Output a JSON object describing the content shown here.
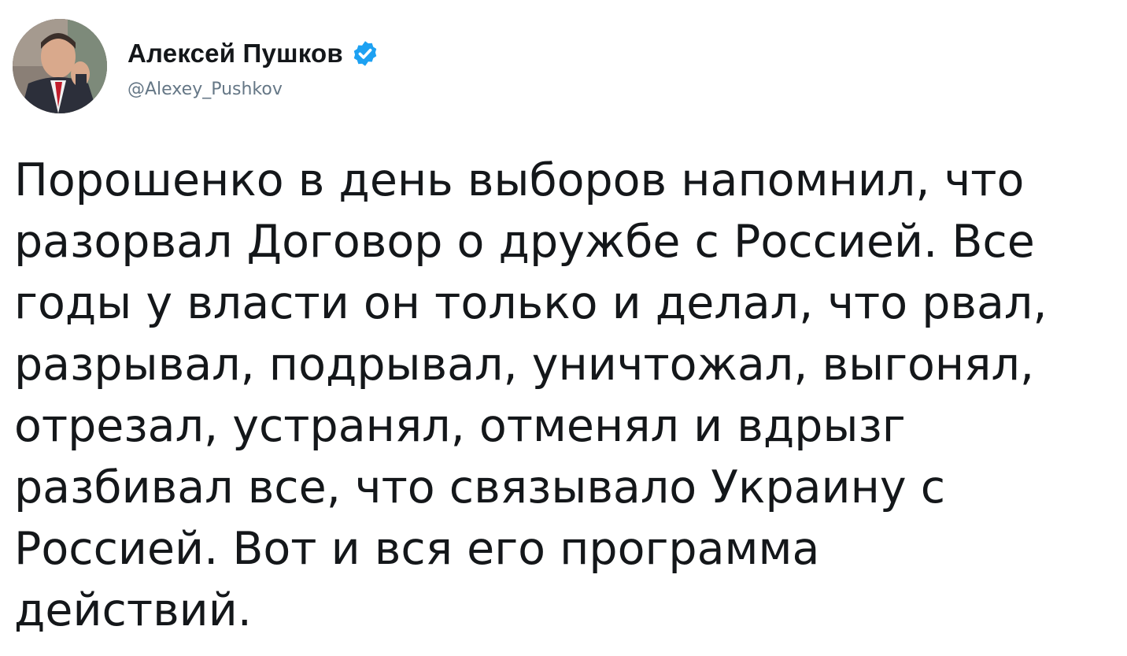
{
  "author": {
    "display_name": "Алексей Пушков",
    "handle": "@Alexey_Pushkov",
    "verified_icon": "verified-badge-icon",
    "avatar": "avatar-photo"
  },
  "tweet": {
    "lines": [
      "Порошенко в день выборов напомнил, что",
      "разорвал Договор о дружбе с Россией. Все",
      "годы у власти он только и делал, что рвал,",
      "разрывал, подрывал, уничтожал, выгонял,",
      "отрезал, устранял, отменял и вдрызг",
      "разбивал все, что связывало Украину с",
      "Россией. Вот и вся его программа",
      "действий."
    ]
  },
  "colors": {
    "text": "#14171a",
    "secondary": "#657786",
    "verified": "#1da1f2",
    "background": "#ffffff"
  }
}
